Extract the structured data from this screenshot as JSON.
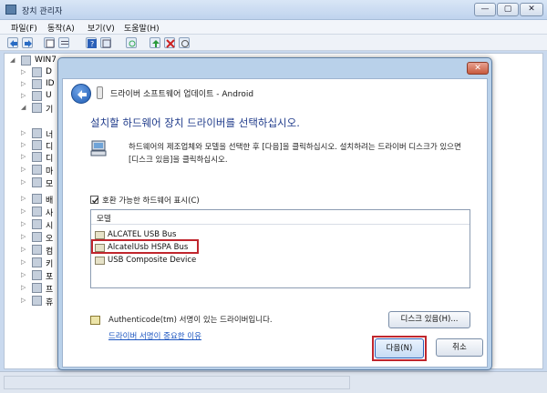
{
  "main_window": {
    "title": "장치 관리자",
    "controls": {
      "minimize": "—",
      "maximize": "▢",
      "close": "✕"
    }
  },
  "menu": {
    "file": "파일(F)",
    "action": "동작(A)",
    "view": "보기(V)",
    "help": "도움말(H)"
  },
  "toolbar": {
    "icons": [
      "back-arrow-icon",
      "forward-arrow-icon",
      "properties-icon",
      "list-icon",
      "help-icon",
      "view-icon",
      "scan-icon",
      "update-driver-icon",
      "uninstall-icon",
      "disable-icon"
    ]
  },
  "tree": {
    "root": "WIN7",
    "items": [
      "D",
      "ID",
      "U",
      "기",
      "너",
      "디",
      "디",
      "마",
      "모",
      "배",
      "사",
      "시",
      "오",
      "컴",
      "키",
      "포",
      "프",
      "휴"
    ]
  },
  "dialog": {
    "title": "드라이버 소프트웨어 업데이트 - Android",
    "close": "✕",
    "instruction": "설치할 하드웨어 장치 드라이버를 선택하십시오.",
    "description": "하드웨어의 제조업체와 모델을 선택한 후 [다음]을 클릭하십시오. 설치하려는 드라이버 디스크가 있으면 [디스크 있음]을 클릭하십시오.",
    "compat_label": "호환 가능한 하드웨어 표시(C)",
    "compat_checked": true,
    "model_header": "모델",
    "models": [
      "ALCATEL USB Bus",
      "AlcatelUsb HSPA Bus",
      "USB Composite Device"
    ],
    "selected_model": "AlcatelUsb HSPA Bus",
    "cert_text": "Authenticode(tm) 서명이 있는 드라이버입니다.",
    "cert_link": "드라이버 서명이 중요한 이유",
    "disk_button": "디스크 있음(H)...",
    "next_button": "다음(N)",
    "cancel_button": "취소"
  },
  "colors": {
    "instruction_blue": "#1e3a8a",
    "link_blue": "#1a54c0",
    "highlight_red": "#c0262d",
    "window_frame": "#b9d1ea"
  }
}
